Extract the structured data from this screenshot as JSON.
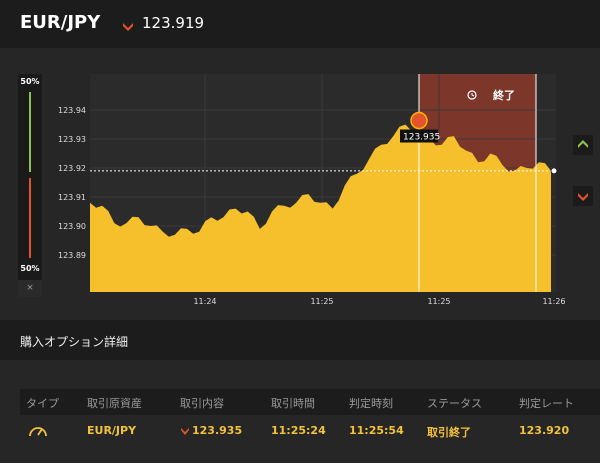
{
  "header": {
    "pair": "EUR/JPY",
    "price": "123.919",
    "price_direction_icon": "down-arrow-icon"
  },
  "gauge": {
    "top_label": "50%",
    "bottom_label": "50%",
    "close_label": "×",
    "colors": {
      "up": "#8bc34a",
      "down": "#e2542b"
    }
  },
  "chart": {
    "end_label": "終了",
    "marker_price": "123.935",
    "y_ticks": [
      "123.94",
      "123.93",
      "123.92",
      "123.91",
      "123.90",
      "123.89"
    ],
    "x_ticks": [
      "11:24",
      "11:25",
      "11:25",
      "11:26"
    ],
    "colors": {
      "area": "#f5c02c",
      "end_zone": "#8b3a2a"
    }
  },
  "chart_data": {
    "type": "area",
    "title": "",
    "xlabel": "",
    "ylabel": "",
    "ylim": [
      123.88,
      123.945
    ],
    "x_ticks": [
      "11:24",
      "11:25",
      "11:25",
      "11:26"
    ],
    "y_ticks": [
      123.94,
      123.93,
      123.92,
      123.91,
      123.9,
      123.89
    ],
    "current_price": 123.919,
    "purchase_price": 123.935,
    "series": [
      {
        "values": [
          123.908,
          123.907,
          123.901,
          123.901,
          123.903,
          123.9,
          123.898,
          123.897,
          123.899,
          123.898,
          123.903,
          123.903,
          123.906,
          123.905,
          123.899,
          123.905,
          123.907,
          123.908,
          123.911,
          123.908,
          123.906,
          123.914,
          123.918,
          123.923,
          123.928,
          123.931,
          123.935,
          123.933,
          123.93,
          123.928,
          123.931,
          123.926,
          123.922,
          123.925,
          123.921,
          123.919,
          123.92,
          123.922,
          123.919
        ]
      }
    ]
  },
  "details": {
    "title": "購入オプション詳細",
    "headers": [
      "タイプ",
      "取引原資産",
      "取引内容",
      "取引時間",
      "判定時刻",
      "ステータス",
      "判定レート"
    ],
    "row": {
      "type_icon": "gauge-icon",
      "asset": "EUR/JPY",
      "direction_icon": "down-arrow-icon",
      "content": "123.935",
      "trade_time": "11:25:24",
      "judge_time": "11:25:54",
      "status": "取引終了",
      "rate": "123.920"
    }
  }
}
